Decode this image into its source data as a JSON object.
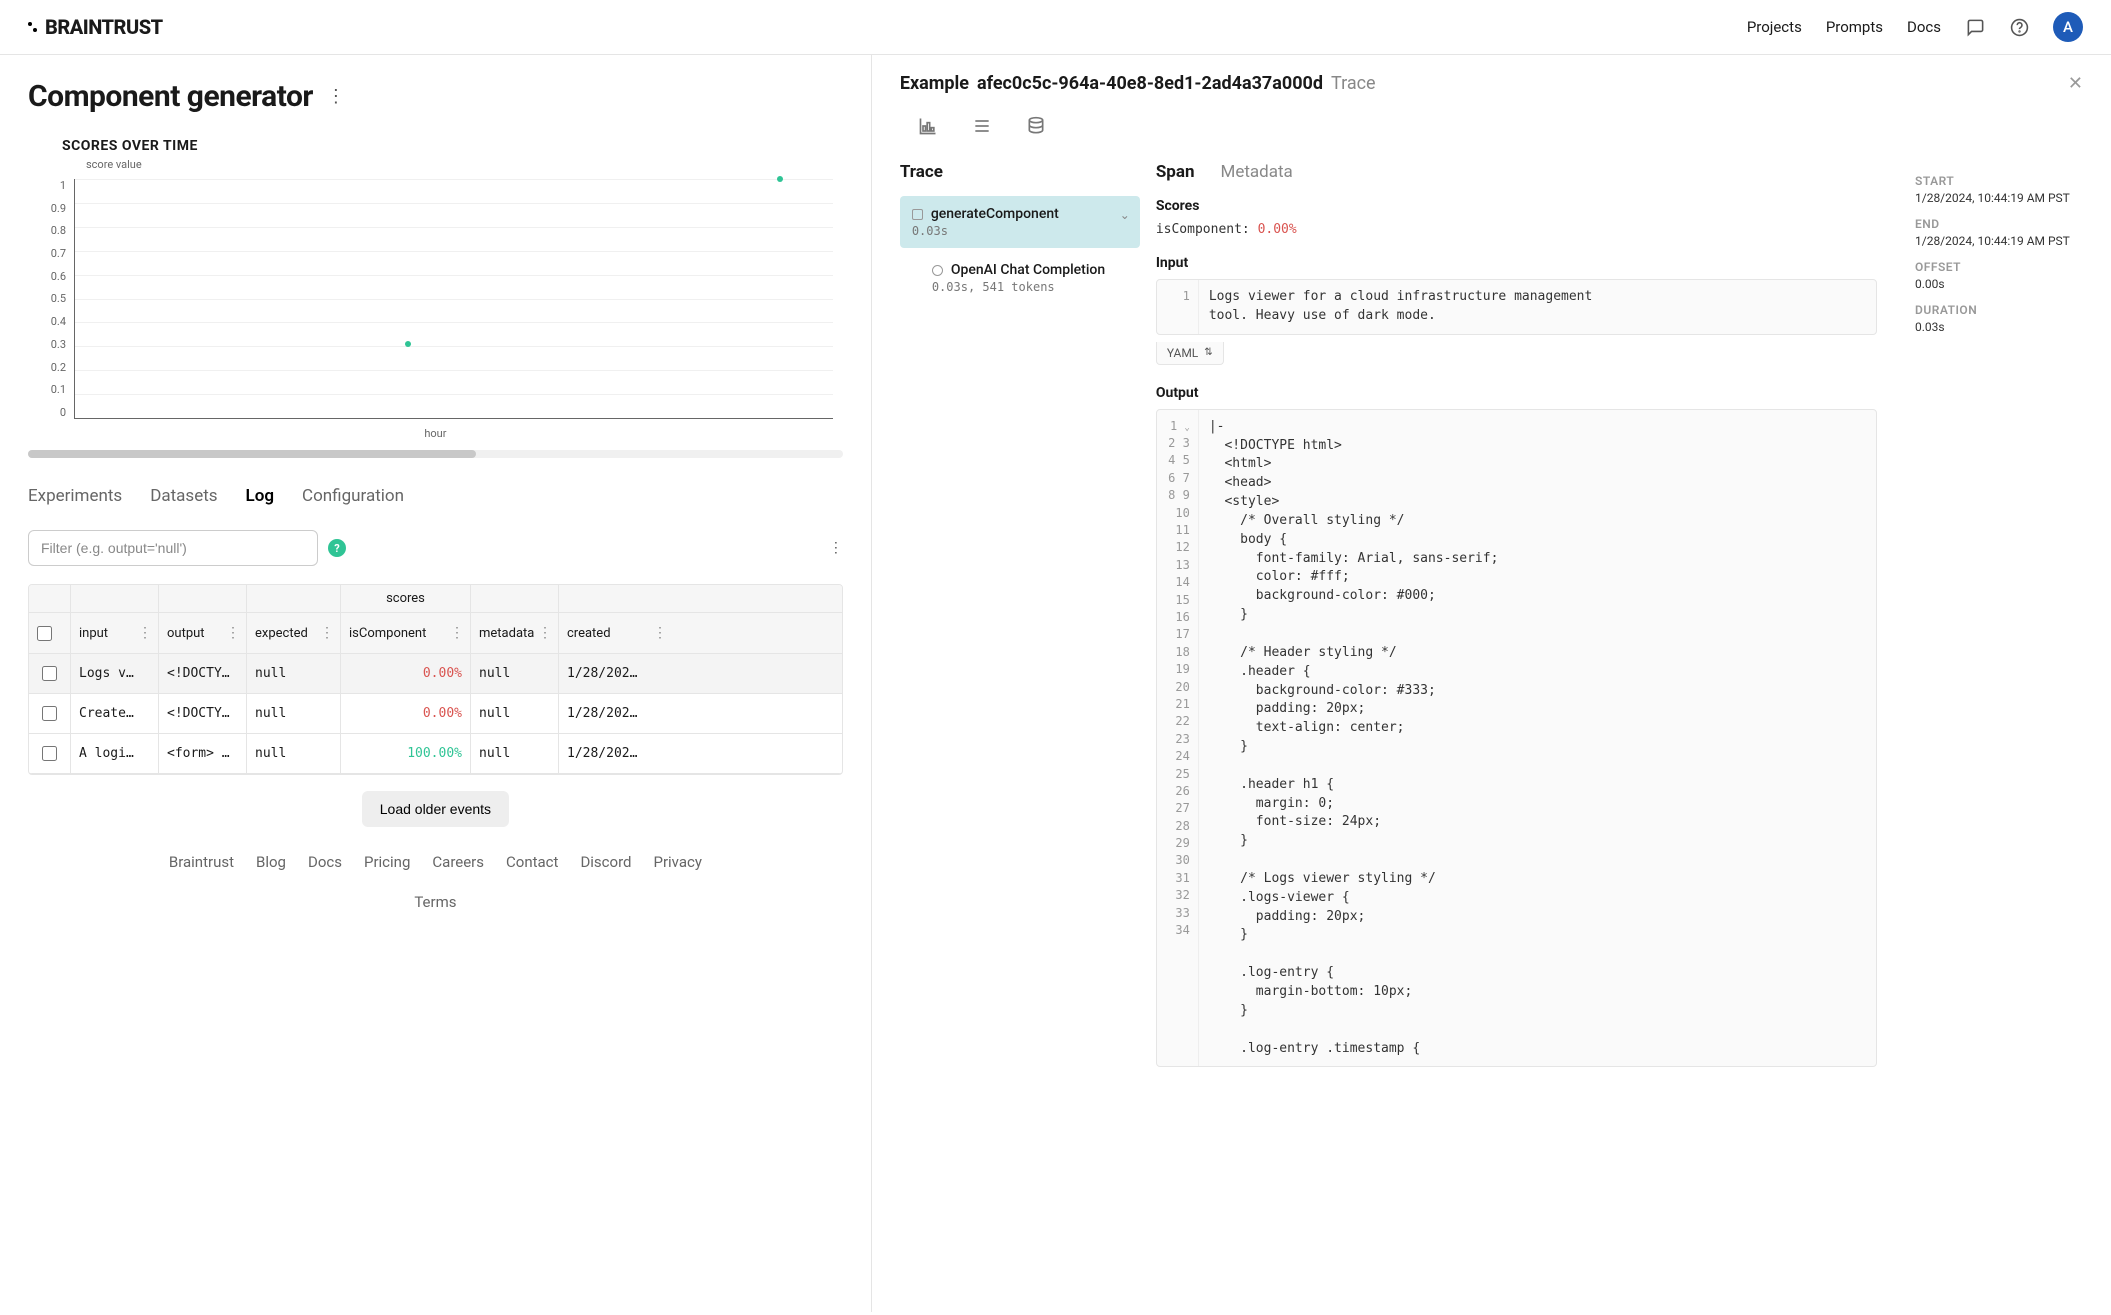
{
  "brand": "BRAINTRUST",
  "nav": {
    "projects": "Projects",
    "prompts": "Prompts",
    "docs": "Docs"
  },
  "avatar_initial": "A",
  "page_title": "Component generator",
  "chart_data": {
    "type": "scatter",
    "title": "SCORES OVER TIME",
    "ylabel": "score value",
    "xlabel": "hour",
    "y_ticks": [
      1,
      0.9,
      0.8,
      0.7,
      0.6,
      0.5,
      0.4,
      0.3,
      0.2,
      0.1,
      0
    ],
    "points": [
      {
        "x": 0.44,
        "y": 0.31
      },
      {
        "x": 0.93,
        "y": 1.0
      }
    ],
    "ylim": [
      0,
      1
    ]
  },
  "tabs": {
    "experiments": "Experiments",
    "datasets": "Datasets",
    "log": "Log",
    "configuration": "Configuration"
  },
  "filter_placeholder": "Filter (e.g. output='null')",
  "table": {
    "group_header_scores": "scores",
    "columns": {
      "input": "input",
      "output": "output",
      "expected": "expected",
      "isComponent": "isComponent",
      "metadata": "metadata",
      "created": "created"
    },
    "rows": [
      {
        "input": "Logs v…",
        "output": "<!DOCTY…",
        "expected": "null",
        "score": "0.00%",
        "score_class": "red",
        "metadata": "null",
        "created": "1/28/202…"
      },
      {
        "input": "Create…",
        "output": "<!DOCTY…",
        "expected": "null",
        "score": "0.00%",
        "score_class": "red",
        "metadata": "null",
        "created": "1/28/202…"
      },
      {
        "input": "A logi…",
        "output": "<form> …",
        "expected": "null",
        "score": "100.00%",
        "score_class": "green",
        "metadata": "null",
        "created": "1/28/202…"
      }
    ],
    "load_more": "Load older events"
  },
  "footer": {
    "braintrust": "Braintrust",
    "blog": "Blog",
    "docs": "Docs",
    "pricing": "Pricing",
    "careers": "Careers",
    "contact": "Contact",
    "discord": "Discord",
    "privacy": "Privacy",
    "terms": "Terms"
  },
  "detail": {
    "title_prefix": "Example",
    "title_id": "afec0c5c-964a-40e8-8ed1-2ad4a37a000d",
    "title_suffix": "Trace",
    "trace_heading": "Trace",
    "trace_items": [
      {
        "name": "generateComponent",
        "meta": "0.03s",
        "active": true
      },
      {
        "name": "OpenAI Chat Completion",
        "meta": "0.03s, 541 tokens",
        "active": false
      }
    ],
    "span_tabs": {
      "span": "Span",
      "metadata": "Metadata"
    },
    "scores_label": "Scores",
    "scores_key": "isComponent:",
    "scores_val": "0.00%",
    "input_label": "Input",
    "input_text": "Logs viewer for a cloud infrastructure management\ntool. Heavy use of dark mode.",
    "yaml_label": "YAML",
    "output_label": "Output",
    "output_lines": [
      "|-",
      "  <!DOCTYPE html>",
      "  <html>",
      "  <head>",
      "  <style>",
      "    /* Overall styling */",
      "    body {",
      "      font-family: Arial, sans-serif;",
      "      color: #fff;",
      "      background-color: #000;",
      "    }",
      "",
      "    /* Header styling */",
      "    .header {",
      "      background-color: #333;",
      "      padding: 20px;",
      "      text-align: center;",
      "    }",
      "",
      "    .header h1 {",
      "      margin: 0;",
      "      font-size: 24px;",
      "    }",
      "",
      "    /* Logs viewer styling */",
      "    .logs-viewer {",
      "      padding: 20px;",
      "    }",
      "",
      "    .log-entry {",
      "      margin-bottom: 10px;",
      "    }",
      "",
      "    .log-entry .timestamp {"
    ],
    "meta": {
      "start_label": "START",
      "start": "1/28/2024, 10:44:19 AM PST",
      "end_label": "END",
      "end": "1/28/2024, 10:44:19 AM PST",
      "offset_label": "OFFSET",
      "offset": "0.00s",
      "duration_label": "DURATION",
      "duration": "0.03s"
    }
  }
}
